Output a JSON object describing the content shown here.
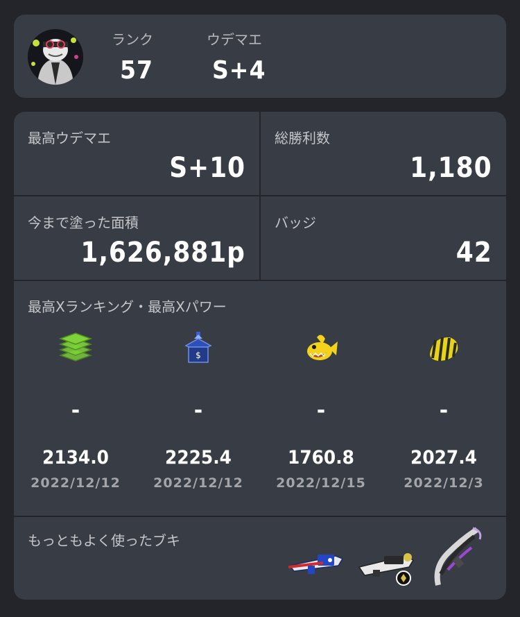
{
  "profile": {
    "rank_label": "ランク",
    "rank_value": "57",
    "udemae_label": "ウデマエ",
    "udemae_value": "S+4"
  },
  "stats": {
    "max_udemae_label": "最高ウデマエ",
    "max_udemae_value": "S+10",
    "total_wins_label": "総勝利数",
    "total_wins_value": "1,180",
    "turf_label": "今まで塗った面積",
    "turf_value": "1,626,881p",
    "badges_label": "バッジ",
    "badges_value": "42"
  },
  "x_section": {
    "title": "最高Xランキング・最高Xパワー",
    "modes": [
      {
        "icon": "splat-zones-icon",
        "rank": "-",
        "power": "2134.0",
        "date": "2022/12/12"
      },
      {
        "icon": "tower-control-icon",
        "rank": "-",
        "power": "2225.4",
        "date": "2022/12/12"
      },
      {
        "icon": "rainmaker-icon",
        "rank": "-",
        "power": "1760.8",
        "date": "2022/12/15"
      },
      {
        "icon": "clam-blitz-icon",
        "rank": "-",
        "power": "2027.4",
        "date": "2022/12/3"
      }
    ]
  },
  "weapons": {
    "title": "もっともよく使ったブキ",
    "items": [
      "blaster-weapon-icon",
      "shooter-weapon-icon",
      "brella-weapon-icon"
    ]
  },
  "colors": {
    "background": "#23252b",
    "card": "#383c45",
    "text": "#ffffff",
    "label": "#c4c6ca"
  }
}
